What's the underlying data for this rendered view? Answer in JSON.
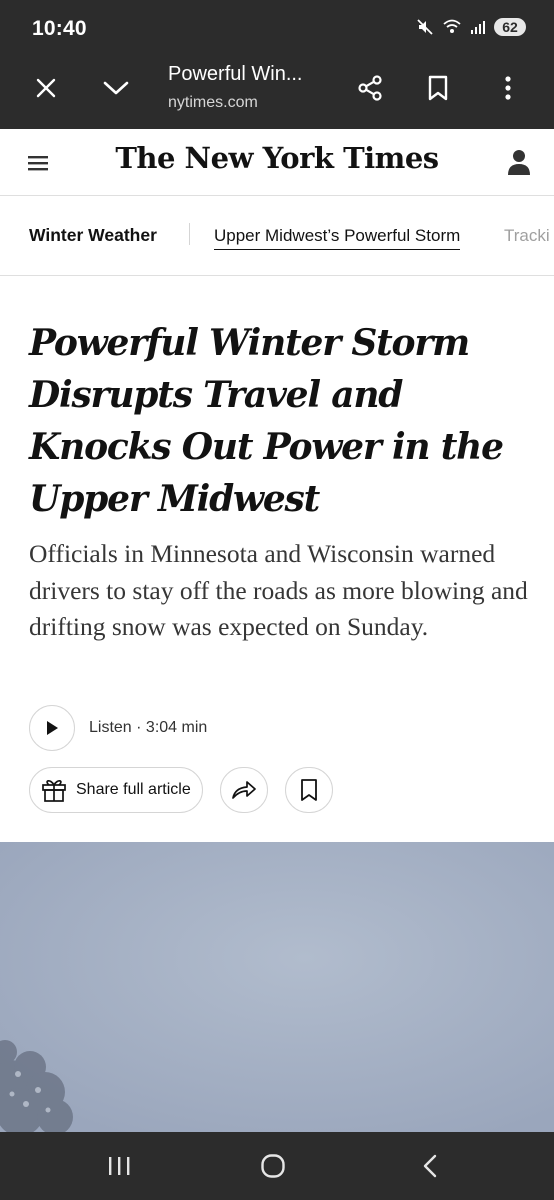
{
  "status_bar": {
    "time": "10:40",
    "battery": "62",
    "icons": [
      "mute-icon",
      "wifi-icon",
      "signal-icon",
      "battery-icon"
    ]
  },
  "browser": {
    "page_title": "Powerful Win...",
    "url": "nytimes.com",
    "buttons": [
      "close-icon",
      "chevron-down-icon",
      "share-icon",
      "bookmark-icon",
      "more-vert-icon"
    ]
  },
  "header": {
    "masthead": "The New York Times"
  },
  "section_nav": {
    "label": "Winter Weather",
    "links": [
      "Upper Midwest’s Powerful Storm",
      "Tracki"
    ]
  },
  "article": {
    "headline": "Powerful Winter Storm Disrupts Travel and Knocks Out Power in the Upper Midwest",
    "summary": "Officials in Minnesota and Wisconsin warned drivers to stay off the roads as more blowing and drifting snow was expected on Sunday.",
    "listen": "Listen · 3:04 min",
    "share_label": "Share full article"
  },
  "colors": {
    "chrome": "#2c2c2c",
    "text": "#121212",
    "border": "#dfdfdf",
    "hero_sky": "#a2aec3"
  }
}
